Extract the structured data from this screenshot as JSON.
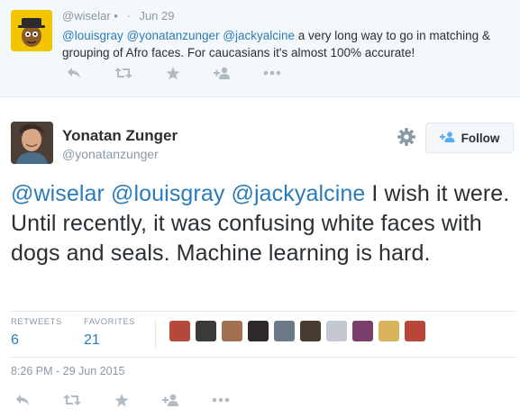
{
  "reply_tweet": {
    "handle": "@wiselar",
    "badge": "•",
    "date": "Jun 29",
    "mentions": [
      "@louisgray",
      "@yonatanzunger",
      "@jackyalcine"
    ],
    "text": "a very long way to go in matching & grouping of Afro faces. For caucasians it's almost 100% accurate!"
  },
  "main_tweet": {
    "name": "Yonatan Zunger",
    "handle": "@yonatanzunger",
    "follow_label": "Follow",
    "mentions": [
      "@wiselar",
      "@louisgray",
      "@jackyalcine"
    ],
    "text": "I wish it were. Until recently, it was confusing white faces with dogs and seals. Machine learning is hard.",
    "stats": {
      "retweets_label": "RETWEETS",
      "retweets": "6",
      "favorites_label": "FAVORITES",
      "favorites": "21"
    },
    "timestamp": "8:26 PM - 29 Jun 2015"
  },
  "actions": [
    "reply-icon",
    "retweet-icon",
    "favorite-icon",
    "follow-plus-icon",
    "more-icon"
  ],
  "colors": {
    "link": "#2b7bb9",
    "muted": "#8899a6",
    "accent": "#55acee",
    "text": "#292f33"
  }
}
